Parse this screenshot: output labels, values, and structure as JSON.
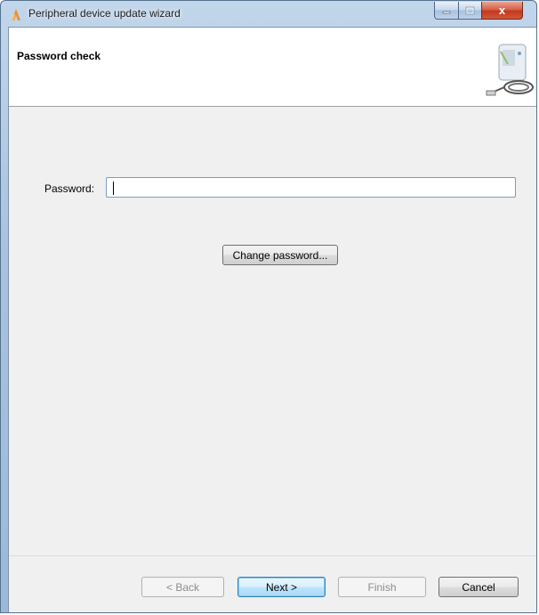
{
  "window": {
    "title": "Peripheral device update wizard",
    "minimize_icon": "minimize-icon",
    "maximize_icon": "maximize-icon",
    "close_icon": "close-icon",
    "close_glyph": "x"
  },
  "header": {
    "title": "Password check",
    "image_icon": "device-with-cable-icon"
  },
  "form": {
    "password_label": "Password:",
    "password_value": "",
    "change_password_label": "Change password..."
  },
  "footer": {
    "back_label": "< Back",
    "next_label": "Next >",
    "finish_label": "Finish",
    "cancel_label": "Cancel"
  },
  "colors": {
    "accent": "#3c7fb1",
    "close": "#c3381e",
    "app_icon": "#e8902a"
  }
}
